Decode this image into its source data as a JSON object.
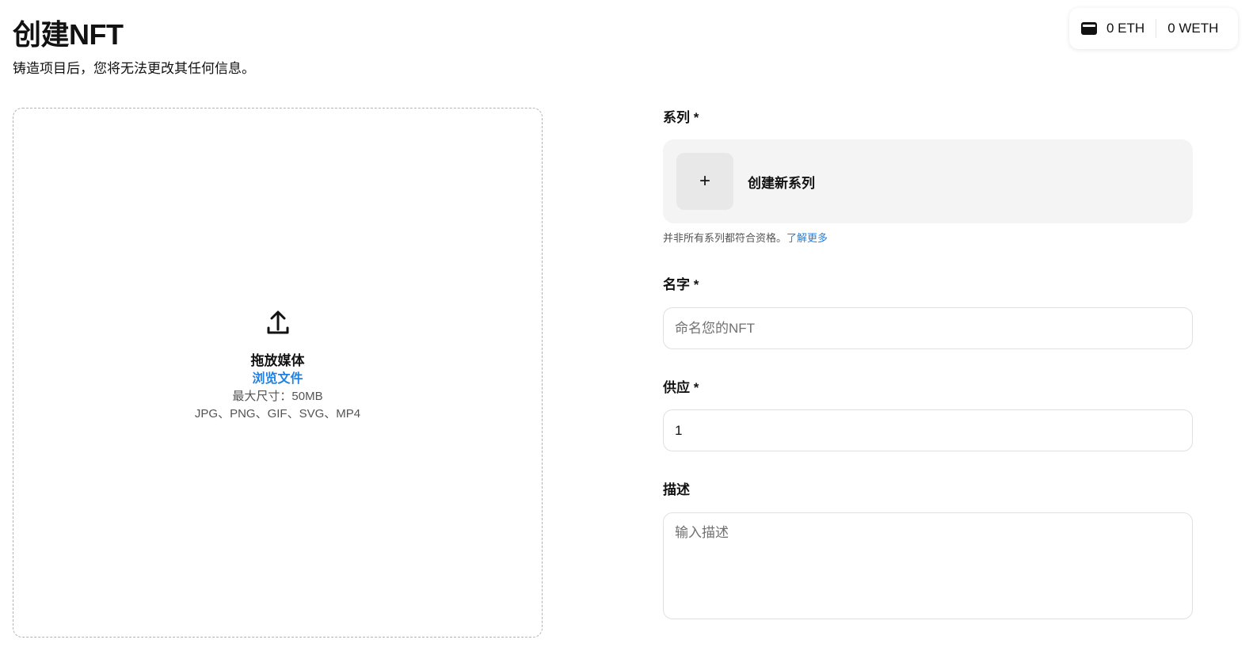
{
  "header": {
    "title": "创建NFT",
    "subtitle": "铸造项目后，您将无法更改其任何信息。"
  },
  "wallet": {
    "icon": "wallet-icon",
    "eth_balance": "0 ETH",
    "weth_balance": "0 WETH"
  },
  "dropzone": {
    "icon": "upload-icon",
    "title": "拖放媒体",
    "browse_label": "浏览文件",
    "max_size": "最大尺寸：50MB",
    "formats": "JPG、PNG、GIF、SVG、MP4"
  },
  "form": {
    "collection": {
      "label": "系列 *",
      "create_label": "创建新系列",
      "plus_icon": "+",
      "hint": "并非所有系列都符合资格。",
      "learn_more": "了解更多"
    },
    "name": {
      "label": "名字 *",
      "placeholder": "命名您的NFT",
      "value": ""
    },
    "supply": {
      "label": "供应 *",
      "value": "1"
    },
    "description": {
      "label": "描述",
      "placeholder": "输入描述",
      "value": ""
    }
  },
  "colors": {
    "accent": "#2081e2",
    "text": "#121212",
    "muted": "#545454",
    "card_bg": "#f4f4f4"
  }
}
